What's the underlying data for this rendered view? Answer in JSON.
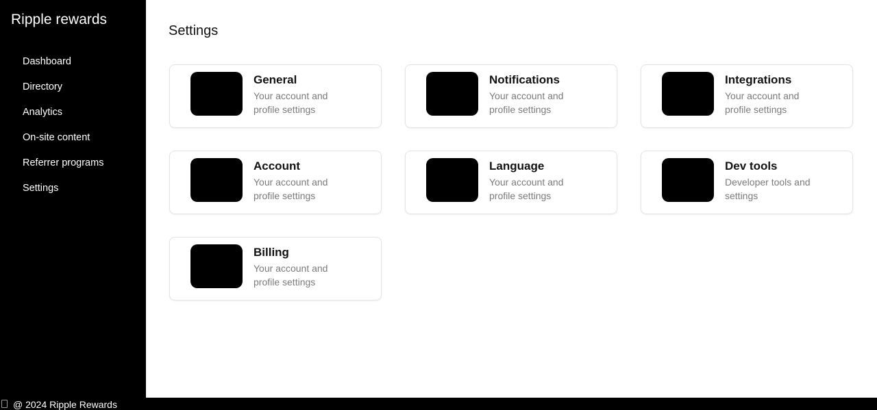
{
  "sidebar": {
    "brand": "Ripple rewards",
    "items": [
      {
        "label": "Dashboard"
      },
      {
        "label": "Directory"
      },
      {
        "label": "Analytics"
      },
      {
        "label": "On-site content"
      },
      {
        "label": "Referrer programs"
      },
      {
        "label": "Settings"
      }
    ]
  },
  "main": {
    "title": "Settings",
    "cards": [
      {
        "title": "General",
        "description": "Your account and profile settings"
      },
      {
        "title": "Notifications",
        "description": "Your account and profile settings"
      },
      {
        "title": "Integrations",
        "description": "Your account and profile settings"
      },
      {
        "title": "Account",
        "description": "Your account and profile settings"
      },
      {
        "title": "Language",
        "description": "Your account and profile settings"
      },
      {
        "title": "Dev tools",
        "description": "Developer tools and settings"
      },
      {
        "title": "Billing",
        "description": "Your account and profile settings"
      }
    ]
  },
  "footer": {
    "icon": "file-icon",
    "text": "@ 2024 Ripple Rewards"
  },
  "colors": {
    "sidebar_bg": "#000000",
    "card_icon": "#000000",
    "desc_text": "#7a7a7a"
  }
}
